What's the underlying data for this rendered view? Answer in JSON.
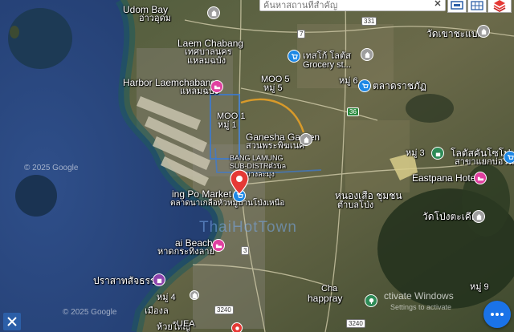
{
  "search": {
    "placeholder": "ค้นหาสถานที่สำคัญ"
  },
  "places": {
    "udom_bay": "Udom Bay",
    "udom_bay_th": "อ่าวอุดม",
    "laem_chabang": "Laem Chabang",
    "laem_chabang_th1": "เทศบาลนคร",
    "laem_chabang_th2": "แหลมฉบัง",
    "harbor": "Harbor Laemchabang",
    "harbor_th": "แหลมฉบัง",
    "ganesha": "Ganesha Garden",
    "ganesha_th": "สวนพระพิฆเนศ",
    "bang_lamung": "BANG LAMUNG",
    "sub_district": "SUB-DISTRICT",
    "bang_lamung_th": "ตำบล",
    "bang_lamung_th2": "บางละมุง",
    "moo5": "MOO 5",
    "moo5_th": "หมู่ 5",
    "moo1": "MOO 1",
    "moo1_th": "หมู่ 1",
    "market": "ing Po Market",
    "market_th": "ตลาดนาเกลือหัวหมู่บ้านโป่งเหนือ",
    "beach": "ai Beach",
    "beach_th": "หาดกระทิงลาย",
    "wat_top": "วัดเขาชะแบก",
    "tesco_lotus": "เทสโก้ โลตัส",
    "grocery": "Grocery st...",
    "talad": "ตลาดราชภัฏ",
    "lotus_right": "โลตัสคันโซโฟ",
    "lotus_right2": "สาขาแยกบ่อวิน",
    "eastpana": "Eastpana Hotel",
    "wat_pong": "วัดโป่งตะเคียน",
    "noi_village": "หนองเสือ ชุมชน",
    "noi_village2": "ตำบลโป่ง",
    "prasat": "ปราสาทสัจธรรม",
    "muang": "เมืองล",
    "huay_yai": "ห้วยใหญ่",
    "moo_th_a": "หมู่ 6",
    "moo_th_b": "หมู่ 3",
    "moo_th_c": "หมู่ 4",
    "moo_th_d": "หมู่ 9",
    "happray": "happray",
    "chak": "Cha",
    "uea": "UEA"
  },
  "roads": {
    "r331": "331",
    "r7": "7",
    "r36": "36",
    "r3240a": "3240",
    "r3240b": "3240",
    "r3": "3"
  },
  "watermark": "ThaiHotTown",
  "copyright1": "© 2025 Google",
  "copyright2": "© 2025 Google",
  "activate": "ctivate Windows",
  "activate_sub": "Settings to activate",
  "colors": {
    "accent": "#1a73e8",
    "pin": "#e53935",
    "poi_blue": "#1e88e5",
    "poi_pink": "#e040a0",
    "poi_green": "#2e8b57",
    "poi_purple": "#8e44ad",
    "poi_gray": "#9e9e9e"
  }
}
